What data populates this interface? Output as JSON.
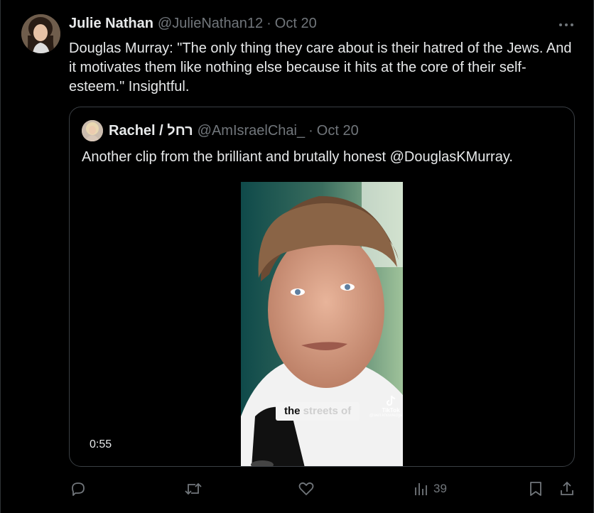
{
  "tweet": {
    "author_name": "Julie Nathan",
    "author_handle": "@JulieNathan12",
    "separator": "·",
    "date": "Oct 20",
    "text": "Douglas Murray: \"The only thing they care about is their hatred of the Jews. And it motivates them like nothing else because it hits at the core of their self-esteem.\" Insightful.",
    "more_icon": "more-icon"
  },
  "quote": {
    "author_name": "Rachel / רחל",
    "author_handle": "@AmIsraelChai_",
    "separator": "·",
    "date": "Oct 20",
    "text_before": "Another clip from the brilliant and brutally honest  ",
    "mention": "@DouglasKMurray",
    "text_after": ".",
    "video": {
      "caption_bold": "the",
      "caption_faded": " streets of",
      "tiktok_label": "TikTok",
      "tiktok_user": "@well.knowledge",
      "duration": "0:55"
    }
  },
  "actions": {
    "reply_icon": "reply-icon",
    "retweet_icon": "retweet-icon",
    "like_icon": "like-icon",
    "views_icon": "views-icon",
    "views_count": "39",
    "bookmark_icon": "bookmark-icon",
    "share_icon": "share-icon"
  },
  "colors": {
    "background": "#000000",
    "text": "#e7e9ea",
    "secondary": "#71767b",
    "border": "#2f3336"
  }
}
